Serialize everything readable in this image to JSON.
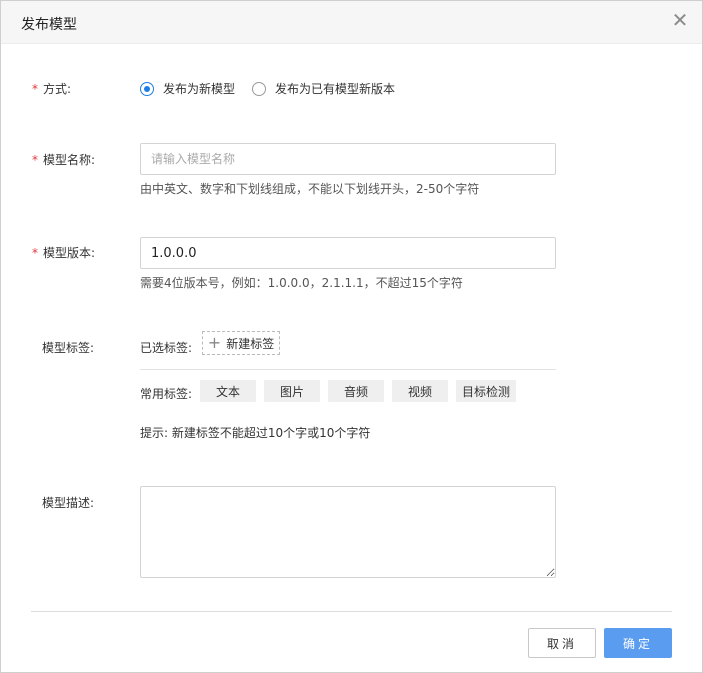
{
  "dialog": {
    "title": "发布模型",
    "close_symbol": "✕"
  },
  "form": {
    "method": {
      "label": "方式:",
      "required_mark": "*",
      "options": [
        {
          "label": "发布为新模型",
          "checked": true
        },
        {
          "label": "发布为已有模型新版本",
          "checked": false
        }
      ]
    },
    "model_name": {
      "label": "模型名称:",
      "required_mark": "*",
      "value": "",
      "placeholder": "请输入模型名称",
      "hint": "由中英文、数字和下划线组成，不能以下划线开头，2-50个字符"
    },
    "model_version": {
      "label": "模型版本:",
      "required_mark": "*",
      "value": "1.0.0.0",
      "hint": "需要4位版本号，例如：1.0.0.0，2.1.1.1，不超过15个字符"
    },
    "model_tags": {
      "label": "模型标签:",
      "selected_label": "已选标签:",
      "new_tag_label": "新建标签",
      "common_label": "常用标签:",
      "common_tags": [
        "文本",
        "图片",
        "音频",
        "视频",
        "目标检测"
      ],
      "tip": "提示: 新建标签不能超过10个字或10个字符"
    },
    "model_desc": {
      "label": "模型描述:",
      "value": ""
    }
  },
  "footer": {
    "cancel_label": "取消",
    "confirm_label": "确定"
  },
  "colors": {
    "accent": "#1e7ce6",
    "primary_button": "#5a9cf0",
    "required": "#e0383e"
  },
  "icons": {
    "close": "close-icon",
    "plus": "plus-icon",
    "resize": "resize-handle-icon"
  }
}
